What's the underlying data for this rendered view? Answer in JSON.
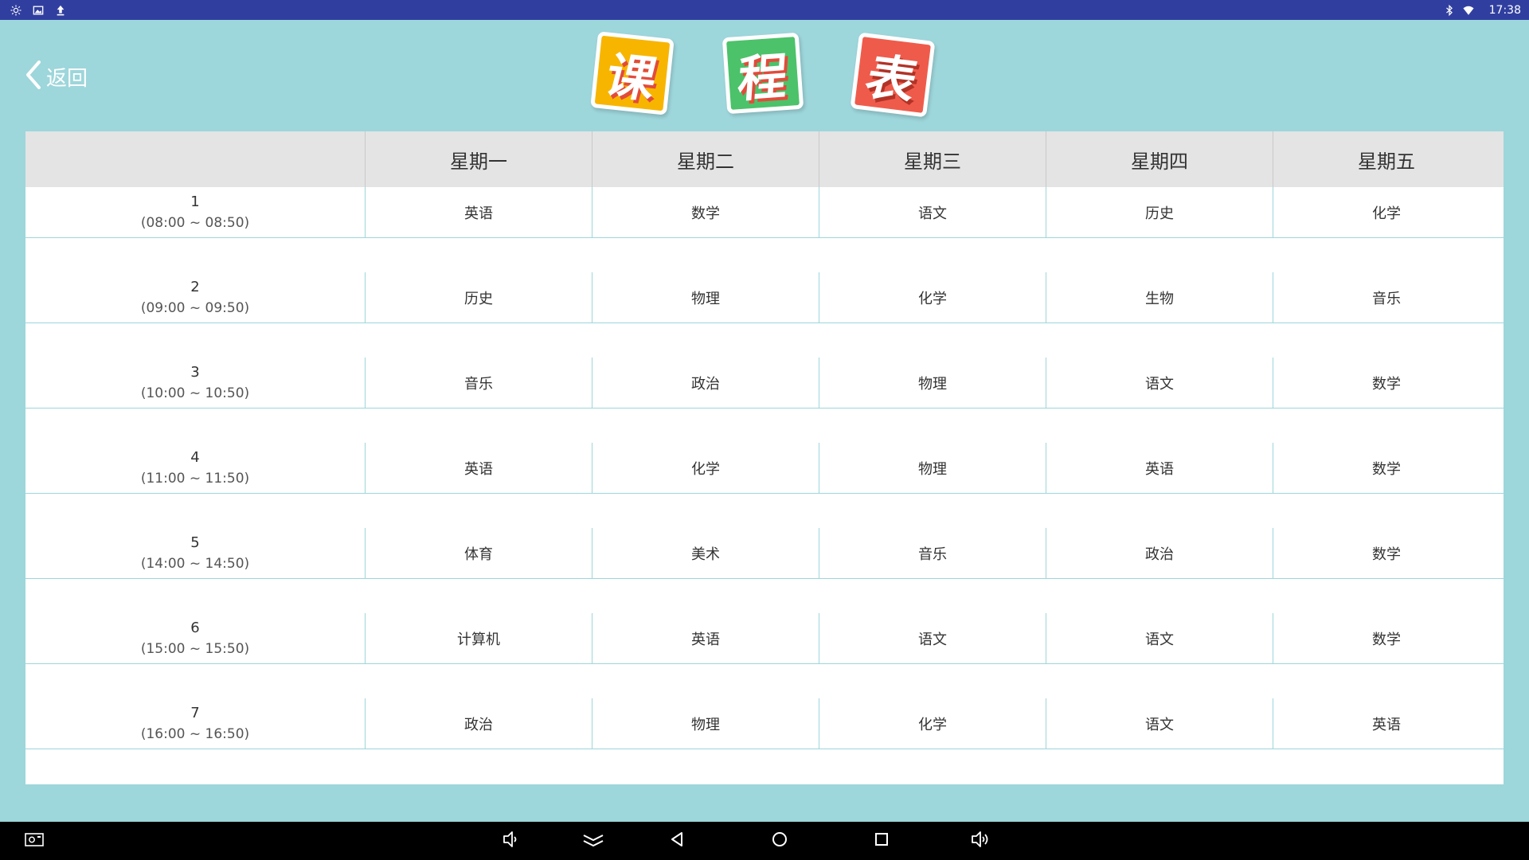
{
  "status_bar": {
    "time": "17:38",
    "left_icons": [
      "brightness-icon",
      "image-icon",
      "upload-icon"
    ],
    "right_icons": [
      "bluetooth-icon",
      "wifi-icon"
    ]
  },
  "header": {
    "back_label": "返回",
    "title_chars": [
      "课",
      "程",
      "表"
    ],
    "tile_colors": [
      "#f7b500",
      "#4cc26a",
      "#ef5b4b"
    ]
  },
  "schedule": {
    "days": [
      "星期一",
      "星期二",
      "星期三",
      "星期四",
      "星期五"
    ],
    "periods": [
      {
        "num": "1",
        "time": "(08:00 ~ 08:50)",
        "classes": [
          "英语",
          "数学",
          "语文",
          "历史",
          "化学"
        ]
      },
      {
        "num": "2",
        "time": "(09:00 ~ 09:50)",
        "classes": [
          "历史",
          "物理",
          "化学",
          "生物",
          "音乐"
        ]
      },
      {
        "num": "3",
        "time": "(10:00 ~ 10:50)",
        "classes": [
          "音乐",
          "政治",
          "物理",
          "语文",
          "数学"
        ]
      },
      {
        "num": "4",
        "time": "(11:00 ~ 11:50)",
        "classes": [
          "英语",
          "化学",
          "物理",
          "英语",
          "数学"
        ]
      },
      {
        "num": "5",
        "time": "(14:00 ~ 14:50)",
        "classes": [
          "体育",
          "美术",
          "音乐",
          "政治",
          "数学"
        ]
      },
      {
        "num": "6",
        "time": "(15:00 ~ 15:50)",
        "classes": [
          "计算机",
          "英语",
          "语文",
          "语文",
          "数学"
        ]
      },
      {
        "num": "7",
        "time": "(16:00 ~ 16:50)",
        "classes": [
          "政治",
          "物理",
          "化学",
          "语文",
          "英语"
        ]
      }
    ]
  },
  "colors": {
    "background": "#9dd6db",
    "status_bar": "#303f9f",
    "table_header": "#e4e4e4",
    "nav_bar": "#000000"
  },
  "nav_bar": {
    "buttons": [
      "screenshot-icon",
      "volume-down-icon",
      "collapse-icon",
      "back-icon",
      "home-icon",
      "recents-icon",
      "volume-up-icon"
    ]
  }
}
